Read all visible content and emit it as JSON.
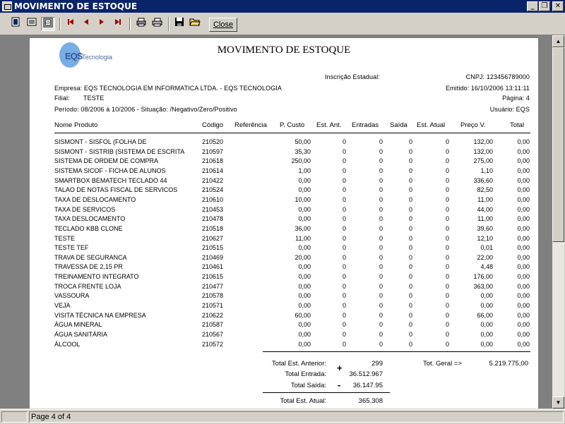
{
  "window": {
    "title": "MOVIMENTO DE ESTOQUE"
  },
  "toolbar": {
    "close_label": "Close"
  },
  "status": {
    "page_text": "Page 4 of 4"
  },
  "report": {
    "title": "MOVIMENTO DE ESTOQUE",
    "logo_text": "EQS",
    "logo_sub": "Tecnologia",
    "inscricao_label": "Inscrição Estadual:",
    "cnpj": "CNPJ: 123456789000",
    "empresa": "Empresa: EQS TECNOLOGIA EM INFORMATICA LTDA. - EQS TECNOLOGIA",
    "emitido": "Emitido: 16/10/2006 13:11:11",
    "filial_label": "Filial:",
    "filial_value": "TESTE",
    "pagina": "Página: 4",
    "periodo": "Período: 08/2006 à 10/2006 - Situação: /Negativo/Zero/Positivo",
    "usuario": "Usuário: EQS"
  },
  "table": {
    "headers": [
      "Nome Produto",
      "Código",
      "Referência",
      "P. Custo",
      "Est. Ant.",
      "Entradas",
      "Saída",
      "Est. Atual",
      "Preço V.",
      "Total"
    ],
    "rows": [
      [
        "SISMONT - SISFOL (FOLHA DE",
        "210520",
        "",
        "50,00",
        "0",
        "0",
        "0",
        "0",
        "132,00",
        "0,00"
      ],
      [
        "SISMONT - SISTRIB (SISTEMA DE ESCRITA",
        "210597",
        "",
        "35,30",
        "0",
        "0",
        "0",
        "0",
        "132,00",
        "0,00"
      ],
      [
        "SISTEMA DE ORDEM DE COMPRA",
        "210618",
        "",
        "250,00",
        "0",
        "0",
        "0",
        "0",
        "275,00",
        "0,00"
      ],
      [
        "SISTEMA SICOF - FICHA DE ALUNOS",
        "210614",
        "",
        "1,00",
        "0",
        "0",
        "0",
        "0",
        "1,10",
        "0,00"
      ],
      [
        "SMARTBOX BEMATECH TECLADO 44",
        "210422",
        "",
        "0,00",
        "0",
        "0",
        "0",
        "0",
        "336,60",
        "0,00"
      ],
      [
        "TALAO DE NOTAS FISCAL DE SERVICOS",
        "210524",
        "",
        "0,00",
        "0",
        "0",
        "0",
        "0",
        "82,50",
        "0,00"
      ],
      [
        "TAXA DE DESLOCAMENTO",
        "210610",
        "",
        "10,00",
        "0",
        "0",
        "0",
        "0",
        "11,00",
        "0,00"
      ],
      [
        "TAXA DE SERVICOS",
        "210453",
        "",
        "0,00",
        "0",
        "0",
        "0",
        "0",
        "44,00",
        "0,00"
      ],
      [
        "TAXA DESLOCAMENTO",
        "210478",
        "",
        "0,00",
        "0",
        "0",
        "0",
        "0",
        "11,00",
        "0,00"
      ],
      [
        "TECLADO KBB CLONE",
        "210518",
        "",
        "36,00",
        "0",
        "0",
        "0",
        "0",
        "39,60",
        "0,00"
      ],
      [
        "TESTE",
        "210627",
        "",
        "11,00",
        "0",
        "0",
        "0",
        "0",
        "12,10",
        "0,00"
      ],
      [
        "TESTE TEF",
        "210515",
        "",
        "0,00",
        "0",
        "0",
        "0",
        "0",
        "0,01",
        "0,00"
      ],
      [
        "TRAVA DE SEGURANCA",
        "210469",
        "",
        "20,00",
        "0",
        "0",
        "0",
        "0",
        "22,00",
        "0,00"
      ],
      [
        "TRAVESSA DE 2,15 PR",
        "210461",
        "",
        "0,00",
        "0",
        "0",
        "0",
        "0",
        "4,48",
        "0,00"
      ],
      [
        "TREINAMENTO INTEGRATO",
        "210615",
        "",
        "0,00",
        "0",
        "0",
        "0",
        "0",
        "176,00",
        "0,00"
      ],
      [
        "TROCA FRENTE LOJA",
        "210477",
        "",
        "0,00",
        "0",
        "0",
        "0",
        "0",
        "363,00",
        "0,00"
      ],
      [
        "VASSOURA",
        "210578",
        "",
        "0,00",
        "0",
        "0",
        "0",
        "0",
        "0,00",
        "0,00"
      ],
      [
        "VEJA",
        "210571",
        "",
        "0,00",
        "0",
        "0",
        "0",
        "0",
        "0,00",
        "0,00"
      ],
      [
        "VISITA TÉCNICA NA EMPRESA",
        "210622",
        "",
        "60,00",
        "0",
        "0",
        "0",
        "0",
        "66,00",
        "0,00"
      ],
      [
        "ÁGUA MINERAL",
        "210587",
        "",
        "0,00",
        "0",
        "0",
        "0",
        "0",
        "0,00",
        "0,00"
      ],
      [
        "ÁGUA SANITÁRIA",
        "210567",
        "",
        "0,00",
        "0",
        "0",
        "0",
        "0",
        "0,00",
        "0,00"
      ],
      [
        "ÁLCOOL",
        "210572",
        "",
        "0,00",
        "0",
        "0",
        "0",
        "0",
        "0,00",
        "0,00"
      ]
    ]
  },
  "totals": {
    "est_anterior_label": "Total Est. Anterior:",
    "est_anterior_value": "299",
    "entrada_label": "Total Entrada:",
    "entrada_value": "36.512.967",
    "saida_label": "Total Saída:",
    "saida_value": "36.147.95",
    "est_atual_label": "Total Est. Atual:",
    "est_atual_value": "365.308",
    "plus_sign": "+",
    "minus_sign": "-",
    "geral_label": "Tot. Geral =>",
    "geral_value": "5.219.775,00"
  }
}
